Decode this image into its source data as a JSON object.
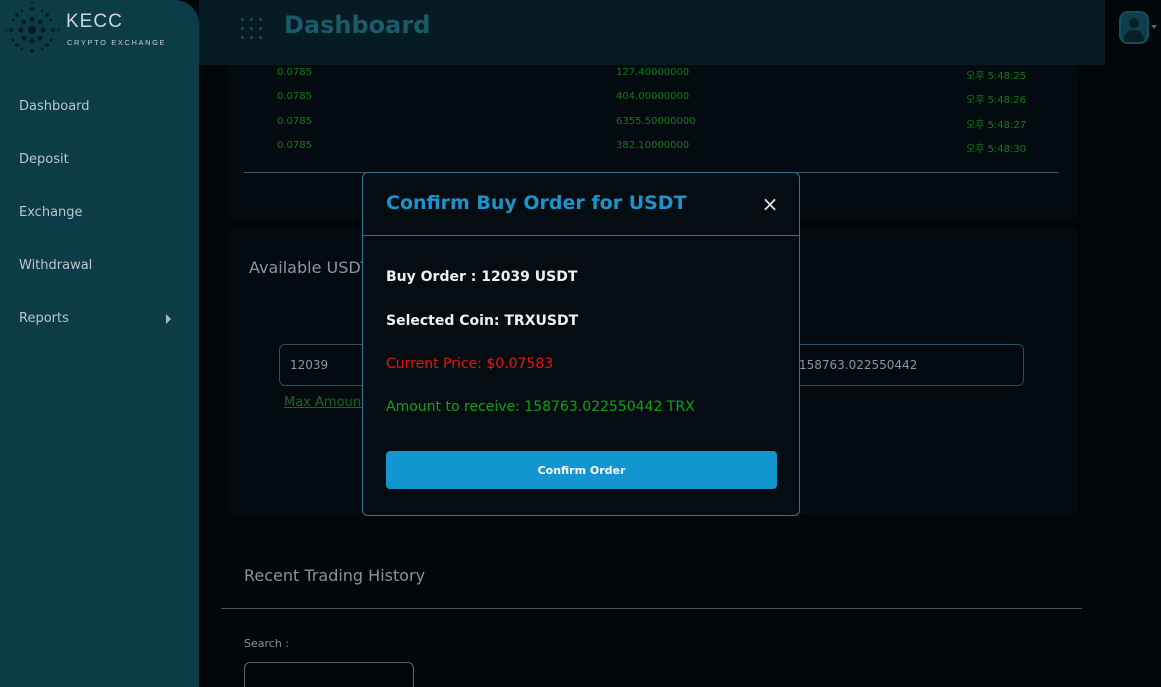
{
  "brand": {
    "name": "KECC",
    "tagline": "CRYPTO EXCHANGE"
  },
  "sidebar": {
    "items": [
      {
        "label": "Dashboard"
      },
      {
        "label": "Deposit"
      },
      {
        "label": "Exchange"
      },
      {
        "label": "Withdrawal"
      },
      {
        "label": "Reports"
      }
    ]
  },
  "header": {
    "title": "Dashboard"
  },
  "trades": {
    "rows": [
      {
        "price": "0.0785",
        "amount": "127.40000000",
        "time": "오후 5:48:25"
      },
      {
        "price": "0.0785",
        "amount": "404.00000000",
        "time": "오후 5:48:26"
      },
      {
        "price": "0.0785",
        "amount": "6355.50000000",
        "time": "오후 5:48:27"
      },
      {
        "price": "0.0785",
        "amount": "382.10000000",
        "time": "오후 5:48:30"
      }
    ]
  },
  "exchange": {
    "available_label": "Available USDT",
    "amount_value": "12039",
    "receive_value": "158763.022550442",
    "max_amount_label": "Max Amount"
  },
  "history": {
    "title": "Recent Trading History",
    "search_label": "Search :"
  },
  "modal": {
    "title": "Confirm Buy Order for USDT",
    "buy_order": "Buy Order : 12039 USDT",
    "selected_coin": "Selected Coin: TRXUSDT",
    "current_price": "Current Price: $0.07583",
    "amount_to_receive": "Amount to receive: 158763.022550442 TRX",
    "confirm_label": "Confirm Order",
    "close_glyph": "×"
  },
  "colors": {
    "accent": "#1395cf",
    "sidebar": "#0b3c48",
    "price_red": "#e5140c",
    "receive_green": "#10a01a"
  },
  "icons": {
    "logo": "dotted-globe-icon",
    "menu": "grid-dots-icon",
    "user": "user-avatar-icon",
    "close": "close-icon"
  }
}
